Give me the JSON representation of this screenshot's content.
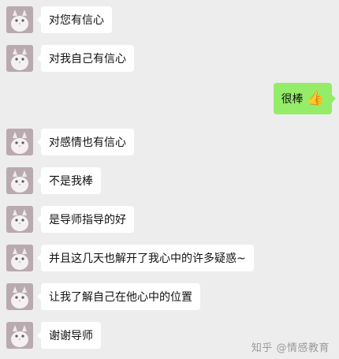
{
  "chat": {
    "messages": [
      {
        "side": "left",
        "text": "对您有信心"
      },
      {
        "side": "left",
        "text": "对我自己有信心"
      },
      {
        "side": "right",
        "text": "很棒",
        "emoji": "👍"
      },
      {
        "side": "left",
        "text": "对感情也有信心"
      },
      {
        "side": "left",
        "text": "不是我棒"
      },
      {
        "side": "left",
        "text": "是导师指导的好"
      },
      {
        "side": "left",
        "text": "并且这几天也解开了我心中的许多疑惑~"
      },
      {
        "side": "left",
        "text": "让我了解自己在他心中的位置"
      },
      {
        "side": "left",
        "text": "谢谢导师"
      }
    ],
    "avatar_icon": "cat-avatar-icon"
  },
  "watermark": "知乎 @情感教育",
  "colors": {
    "background": "#ededed",
    "left_bubble": "#ffffff",
    "right_bubble": "#95ec69"
  }
}
